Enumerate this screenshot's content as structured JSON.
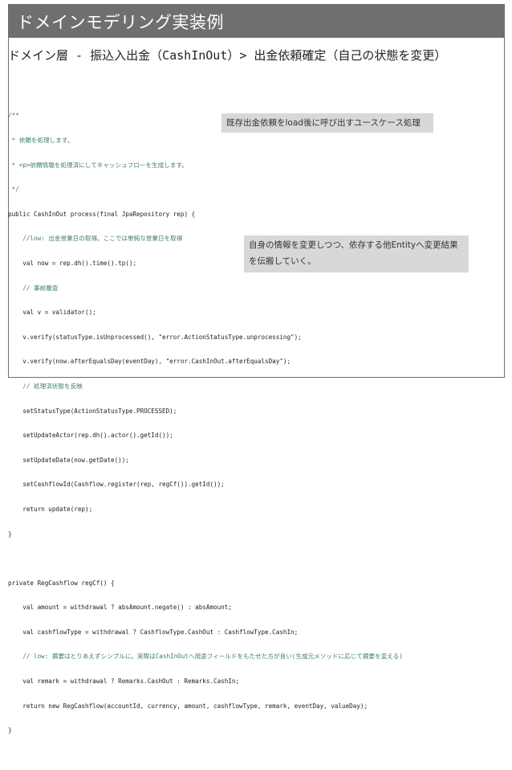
{
  "slide": {
    "title": "ドメインモデリング実装例",
    "subtitle": "ドメイン層 - 振込入出金（CashInOut）> 出金依頼確定（自己の状態を変更）"
  },
  "code_lines": [
    "/**",
    " * 依頼を処理します。",
    " * <p>依頼情報を処理済にしてキャッシュフローを生成します。",
    " */",
    "public CashInOut process(final JpaRepository rep) {",
    "    //low: 出金営業日の取得。ここでは単純な営業日を取得",
    "    val now = rep.dh().time().tp();",
    "    // 事前審査",
    "    val v = validator();",
    "    v.verify(statusType.isUnprocessed(), \"error.ActionStatusType.unprocessing\");",
    "    v.verify(now.afterEqualsDay(eventDay), \"error.CashInOut.afterEqualsDay\");",
    "    // 処理済状態を反映",
    "    setStatusType(ActionStatusType.PROCESSED);",
    "    setUpdateActor(rep.dh().actor().getId());",
    "    setUpdateDate(now.getDate());",
    "    setCashflowId(Cashflow.register(rep, regCf()).getId());",
    "    return update(rep);",
    "}",
    "",
    "private RegCashflow regCf() {",
    "    val amount = withdrawal ? absAmount.negate() : absAmount;",
    "    val cashflowType = withdrawal ? CashflowType.CashOut : CashflowType.CashIn;",
    "    // low: 摘要はとりあえずシンプルに。実際はCashInOutへ用途フィールドをもたせた方が良い(生成元メソッドに応じて摘要を変える)",
    "    val remark = withdrawal ? Remarks.CashOut : Remarks.CashIn;",
    "    return new RegCashflow(accountId, currency, amount, cashflowType, remark, eventDay, valueDay);",
    "}",
    "",
    "..."
  ],
  "callouts": {
    "first": "既存出金依頼をload後に呼び出すユースケース処理",
    "second_line1": "自身の情報を変更しつつ、依存する他Entityへ変更結果",
    "second_line2": "を伝搬していく。"
  }
}
